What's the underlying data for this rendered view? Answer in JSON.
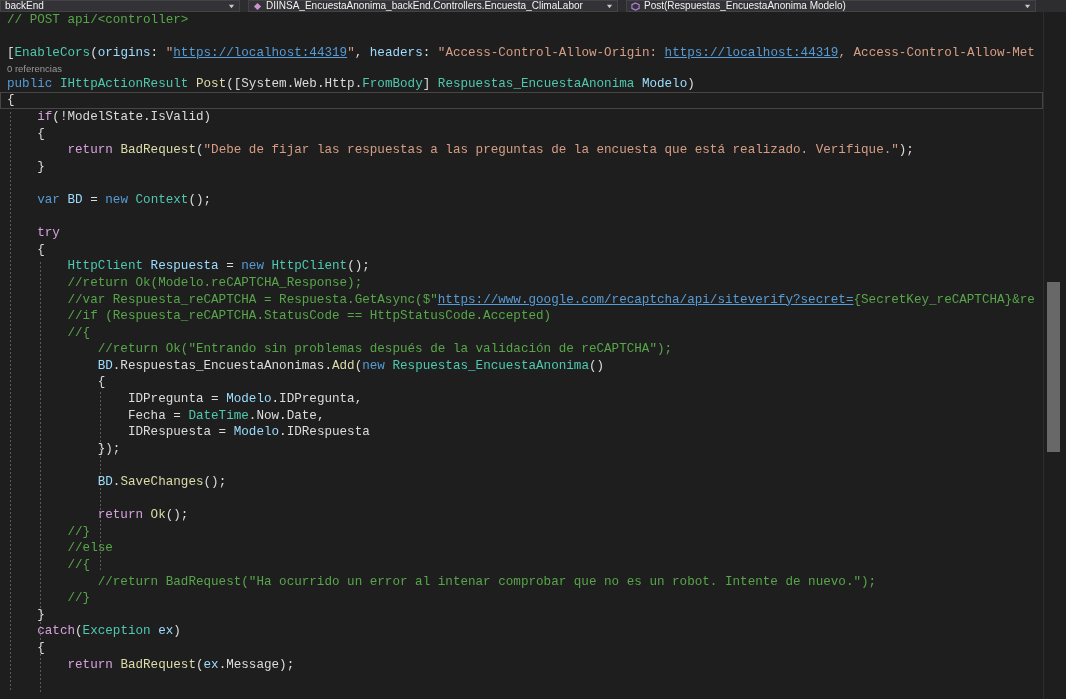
{
  "navigation_bar": {
    "dropdowns": [
      {
        "label": "backEnd",
        "kind": "project"
      },
      {
        "label": "DIINSA_EncuestaAnonima_backEnd.Controllers.Encuesta_ClimaLabor",
        "kind": "class"
      },
      {
        "label": "Post(Respuestas_EncuestaAnonima Modelo)",
        "kind": "member"
      }
    ]
  },
  "editor": {
    "lines": [
      {
        "kind": "code",
        "current": false,
        "tokens": [
          {
            "text": "// POST api/<controller>",
            "kind": "comment"
          }
        ]
      },
      {
        "kind": "blank",
        "current": false
      },
      {
        "kind": "code",
        "current": false,
        "tokens": [
          {
            "text": "[",
            "kind": "plain"
          },
          {
            "text": "EnableCors",
            "kind": "type"
          },
          {
            "text": "(",
            "kind": "plain"
          },
          {
            "text": "origins",
            "kind": "variable"
          },
          {
            "text": ": ",
            "kind": "plain"
          },
          {
            "text": "\"",
            "kind": "string"
          },
          {
            "text": "https://localhost:44319",
            "kind": "link"
          },
          {
            "text": "\"",
            "kind": "string"
          },
          {
            "text": ", ",
            "kind": "plain"
          },
          {
            "text": "headers",
            "kind": "variable"
          },
          {
            "text": ": ",
            "kind": "plain"
          },
          {
            "text": "\"Access-Control-Allow-Origin: ",
            "kind": "string"
          },
          {
            "text": "https://localhost:44319",
            "kind": "link"
          },
          {
            "text": ", Access-Control-Allow-Met",
            "kind": "string"
          }
        ]
      },
      {
        "kind": "codelens",
        "current": false,
        "text": "0 referencias"
      },
      {
        "kind": "code",
        "current": false,
        "tokens": [
          {
            "text": "public ",
            "kind": "keyword"
          },
          {
            "text": "IHttpActionResult ",
            "kind": "type"
          },
          {
            "text": "Post",
            "kind": "method"
          },
          {
            "text": "([System.Web.Http.",
            "kind": "plain"
          },
          {
            "text": "FromBody",
            "kind": "type"
          },
          {
            "text": "] ",
            "kind": "plain"
          },
          {
            "text": "Respuestas_EncuestaAnonima ",
            "kind": "type"
          },
          {
            "text": "Modelo",
            "kind": "variable"
          },
          {
            "text": ")",
            "kind": "plain"
          }
        ]
      },
      {
        "kind": "code",
        "current": true,
        "tokens": [
          {
            "text": "{",
            "kind": "plain"
          }
        ]
      },
      {
        "kind": "code",
        "current": false,
        "tokens": [
          {
            "text": "    if",
            "kind": "control"
          },
          {
            "text": "(!ModelState.IsValid)",
            "kind": "plain"
          }
        ]
      },
      {
        "kind": "code",
        "current": false,
        "tokens": [
          {
            "text": "    {",
            "kind": "plain"
          }
        ]
      },
      {
        "kind": "code",
        "current": false,
        "tokens": [
          {
            "text": "        return ",
            "kind": "control"
          },
          {
            "text": "BadRequest",
            "kind": "method"
          },
          {
            "text": "(",
            "kind": "plain"
          },
          {
            "text": "\"Debe de fijar las respuestas a las preguntas de la encuesta que está realizado. Verifique.\"",
            "kind": "string"
          },
          {
            "text": ");",
            "kind": "plain"
          }
        ]
      },
      {
        "kind": "code",
        "current": false,
        "tokens": [
          {
            "text": "    }",
            "kind": "plain"
          }
        ]
      },
      {
        "kind": "blank",
        "current": false
      },
      {
        "kind": "code",
        "current": false,
        "tokens": [
          {
            "text": "    var ",
            "kind": "keyword"
          },
          {
            "text": "BD",
            "kind": "variable"
          },
          {
            "text": " = ",
            "kind": "plain"
          },
          {
            "text": "new ",
            "kind": "keyword"
          },
          {
            "text": "Context",
            "kind": "type"
          },
          {
            "text": "();",
            "kind": "plain"
          }
        ]
      },
      {
        "kind": "blank",
        "current": false
      },
      {
        "kind": "code",
        "current": false,
        "tokens": [
          {
            "text": "    try",
            "kind": "control"
          }
        ]
      },
      {
        "kind": "code",
        "current": false,
        "tokens": [
          {
            "text": "    {",
            "kind": "plain"
          }
        ]
      },
      {
        "kind": "code",
        "current": false,
        "tokens": [
          {
            "text": "        HttpClient ",
            "kind": "type"
          },
          {
            "text": "Respuesta",
            "kind": "variable"
          },
          {
            "text": " = ",
            "kind": "plain"
          },
          {
            "text": "new ",
            "kind": "keyword"
          },
          {
            "text": "HttpClient",
            "kind": "type"
          },
          {
            "text": "();",
            "kind": "plain"
          }
        ]
      },
      {
        "kind": "code",
        "current": false,
        "tokens": [
          {
            "text": "        //return Ok(Modelo.reCAPTCHA_Response);",
            "kind": "comment"
          }
        ]
      },
      {
        "kind": "code",
        "current": false,
        "tokens": [
          {
            "text": "        //var Respuesta_reCAPTCHA = Respuesta.GetAsync($\"",
            "kind": "comment"
          },
          {
            "text": "https://www.google.com/recaptcha/api/siteverify?secret=",
            "kind": "link"
          },
          {
            "text": "{SecretKey_reCAPTCHA}&re",
            "kind": "comment"
          }
        ]
      },
      {
        "kind": "code",
        "current": false,
        "tokens": [
          {
            "text": "        //if (Respuesta_reCAPTCHA.StatusCode == HttpStatusCode.Accepted)",
            "kind": "comment"
          }
        ]
      },
      {
        "kind": "code",
        "current": false,
        "tokens": [
          {
            "text": "        //{",
            "kind": "comment"
          }
        ]
      },
      {
        "kind": "code",
        "current": false,
        "tokens": [
          {
            "text": "            //return Ok(\"Entrando sin problemas después de la validación de reCAPTCHA\");",
            "kind": "comment"
          }
        ]
      },
      {
        "kind": "code",
        "current": false,
        "tokens": [
          {
            "text": "            BD",
            "kind": "variable"
          },
          {
            "text": ".Respuestas_EncuestaAnonimas.",
            "kind": "plain"
          },
          {
            "text": "Add",
            "kind": "method"
          },
          {
            "text": "(",
            "kind": "plain"
          },
          {
            "text": "new ",
            "kind": "keyword"
          },
          {
            "text": "Respuestas_EncuestaAnonima",
            "kind": "type"
          },
          {
            "text": "()",
            "kind": "plain"
          }
        ]
      },
      {
        "kind": "code",
        "current": false,
        "tokens": [
          {
            "text": "            {",
            "kind": "plain"
          }
        ]
      },
      {
        "kind": "code",
        "current": false,
        "tokens": [
          {
            "text": "                IDPregunta = ",
            "kind": "plain"
          },
          {
            "text": "Modelo",
            "kind": "variable"
          },
          {
            "text": ".IDPregunta,",
            "kind": "plain"
          }
        ]
      },
      {
        "kind": "code",
        "current": false,
        "tokens": [
          {
            "text": "                Fecha = ",
            "kind": "plain"
          },
          {
            "text": "DateTime",
            "kind": "type"
          },
          {
            "text": ".Now.Date,",
            "kind": "plain"
          }
        ]
      },
      {
        "kind": "code",
        "current": false,
        "tokens": [
          {
            "text": "                IDRespuesta = ",
            "kind": "plain"
          },
          {
            "text": "Modelo",
            "kind": "variable"
          },
          {
            "text": ".IDRespuesta",
            "kind": "plain"
          }
        ]
      },
      {
        "kind": "code",
        "current": false,
        "tokens": [
          {
            "text": "            });",
            "kind": "plain"
          }
        ]
      },
      {
        "kind": "blank",
        "current": false
      },
      {
        "kind": "code",
        "current": false,
        "tokens": [
          {
            "text": "            BD",
            "kind": "variable"
          },
          {
            "text": ".",
            "kind": "plain"
          },
          {
            "text": "SaveChanges",
            "kind": "method"
          },
          {
            "text": "();",
            "kind": "plain"
          }
        ]
      },
      {
        "kind": "blank",
        "current": false
      },
      {
        "kind": "code",
        "current": false,
        "tokens": [
          {
            "text": "            return ",
            "kind": "control"
          },
          {
            "text": "Ok",
            "kind": "method"
          },
          {
            "text": "();",
            "kind": "plain"
          }
        ]
      },
      {
        "kind": "code",
        "current": false,
        "tokens": [
          {
            "text": "        //}",
            "kind": "comment"
          }
        ]
      },
      {
        "kind": "code",
        "current": false,
        "tokens": [
          {
            "text": "        //else",
            "kind": "comment"
          }
        ]
      },
      {
        "kind": "code",
        "current": false,
        "tokens": [
          {
            "text": "        //{",
            "kind": "comment"
          }
        ]
      },
      {
        "kind": "code",
        "current": false,
        "tokens": [
          {
            "text": "            //return BadRequest(\"Ha ocurrido un error al intenar comprobar que no es un robot. Intente de nuevo.\");",
            "kind": "comment"
          }
        ]
      },
      {
        "kind": "code",
        "current": false,
        "tokens": [
          {
            "text": "        //}",
            "kind": "comment"
          }
        ]
      },
      {
        "kind": "code",
        "current": false,
        "tokens": [
          {
            "text": "    }",
            "kind": "plain"
          }
        ]
      },
      {
        "kind": "code",
        "current": false,
        "tokens": [
          {
            "text": "    catch",
            "kind": "control"
          },
          {
            "text": "(",
            "kind": "plain"
          },
          {
            "text": "Exception ",
            "kind": "type"
          },
          {
            "text": "ex",
            "kind": "variable"
          },
          {
            "text": ")",
            "kind": "plain"
          }
        ]
      },
      {
        "kind": "code",
        "current": false,
        "tokens": [
          {
            "text": "    {",
            "kind": "plain"
          }
        ]
      },
      {
        "kind": "code",
        "current": false,
        "tokens": [
          {
            "text": "        return ",
            "kind": "control"
          },
          {
            "text": "BadRequest",
            "kind": "method"
          },
          {
            "text": "(",
            "kind": "plain"
          },
          {
            "text": "ex",
            "kind": "variable"
          },
          {
            "text": ".Message);",
            "kind": "plain"
          }
        ]
      }
    ]
  }
}
